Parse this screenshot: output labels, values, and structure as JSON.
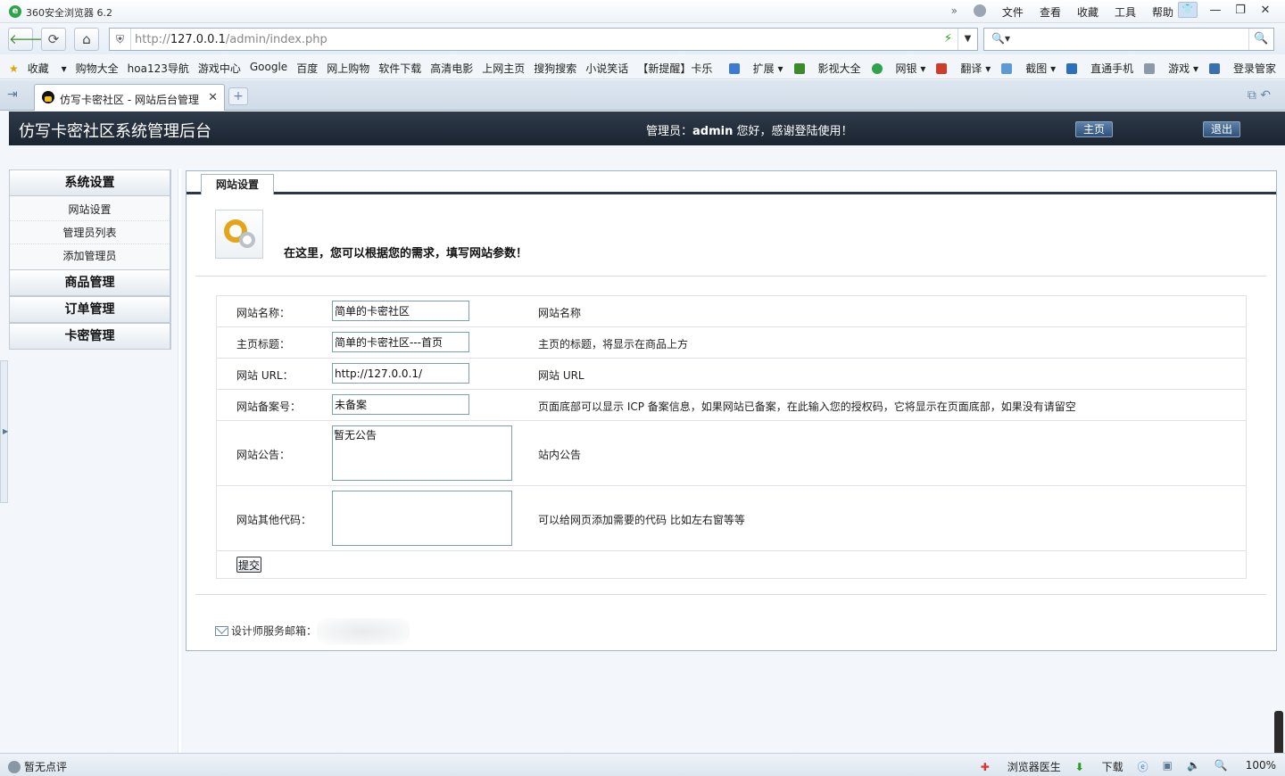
{
  "browser": {
    "app_title": "360安全浏览器 6.2",
    "menu": [
      "文件",
      "查看",
      "收藏",
      "工具",
      "帮助"
    ],
    "url_prefix": "http://",
    "url_host": "127.0.0.1",
    "url_path": "/admin/index.php",
    "bookmarks_left": [
      "收藏",
      "购物大全",
      "hoa123导航",
      "游戏中心",
      "Google",
      "百度",
      "网上购物",
      "软件下载",
      "高清电影",
      "上网主页",
      "搜狗搜索",
      "小说笑话",
      "【新提醒】卡乐"
    ],
    "bookmarks_right": [
      "扩展",
      "影视大全",
      "网银",
      "翻译",
      "截图",
      "直通手机",
      "游戏",
      "登录管家"
    ],
    "tab_title": "仿写卡密社区 - 网站后台管理",
    "status_left": "暂无点评",
    "status_right": [
      "浏览器医生",
      "下载",
      "100%"
    ]
  },
  "header": {
    "site_title": "仿写卡密社区系统管理后台",
    "greet_prefix": "管理员：",
    "admin_name": "admin",
    "greet_suffix": " 您好，感谢登陆使用！",
    "home_btn": "主页",
    "logout_btn": "退出"
  },
  "sidebar": {
    "sections": [
      {
        "title": "系统设置",
        "items": [
          "网站设置",
          "管理员列表",
          "添加管理员"
        ]
      },
      {
        "title": "商品管理",
        "items": []
      },
      {
        "title": "订单管理",
        "items": []
      },
      {
        "title": "卡密管理",
        "items": []
      }
    ]
  },
  "main": {
    "tab_label": "网站设置",
    "intro": "在这里，您可以根据您的需求，填写网站参数！",
    "fields": [
      {
        "label": "网站名称：",
        "value": "简单的卡密社区",
        "desc": "网站名称"
      },
      {
        "label": "主页标题：",
        "value": "简单的卡密社区---首页",
        "desc": "主页的标题，将显示在商品上方"
      },
      {
        "label": "网站 URL：",
        "value": "http://127.0.0.1/",
        "desc": "网站 URL"
      },
      {
        "label": "网站备案号：",
        "value": "未备案",
        "desc": "页面底部可以显示 ICP 备案信息，如果网站已备案，在此输入您的授权码，它将显示在页面底部，如果没有请留空"
      },
      {
        "label": "网站公告：",
        "value": "暂无公告",
        "desc": "站内公告"
      },
      {
        "label": "网站其他代码：",
        "value": "",
        "desc": "可以给网页添加需要的代码 比如左右窗等等"
      }
    ],
    "submit_label": "提交",
    "footer_label": "设计师服务邮箱："
  }
}
